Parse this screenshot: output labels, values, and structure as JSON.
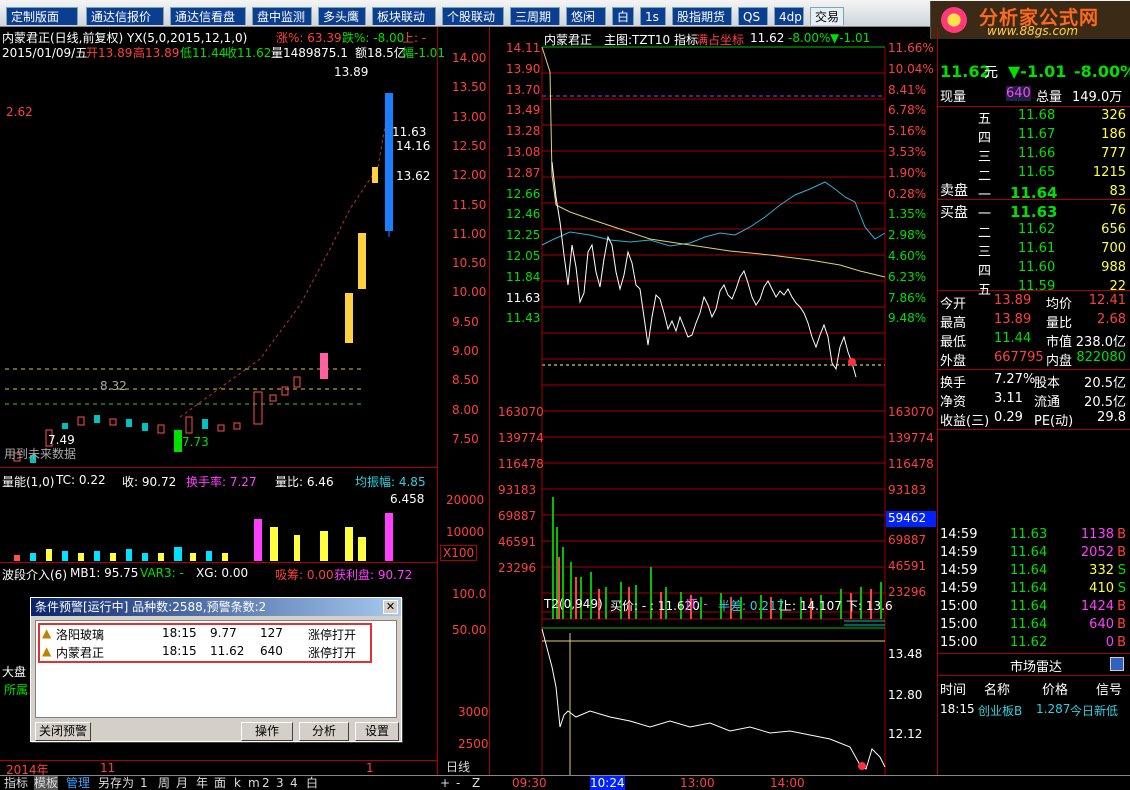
{
  "menu": [
    {
      "label": "定制版面",
      "active": false
    },
    {
      "label": "通达信报价",
      "active": false
    },
    {
      "label": "通达信看盘",
      "active": false
    },
    {
      "label": "盘中监测",
      "active": false
    },
    {
      "label": "多头鹰",
      "active": false
    },
    {
      "label": "板块联动",
      "active": false
    },
    {
      "label": "个股联动",
      "active": false
    },
    {
      "label": "三周期",
      "active": false
    },
    {
      "label": "悠闲",
      "active": false
    },
    {
      "label": "白",
      "active": false
    },
    {
      "label": "1s",
      "active": false
    },
    {
      "label": "股指期货",
      "active": false
    },
    {
      "label": "QS",
      "active": false
    },
    {
      "label": "4dp",
      "active": false
    },
    {
      "label": "交易",
      "active": true
    }
  ],
  "logo": {
    "brand": "分析家公式网",
    "url": "www.88gs.com"
  },
  "kline": {
    "title": "内蒙君正(日线,前复权) YX(5,0,2015,12,1,0)",
    "chg_label": "涨%: 63.39",
    "fall_label": "跌%: -8.00",
    "up_label": "上: -",
    "down_label": "下:",
    "date": "2015/01/09/五",
    "open": "开13.89",
    "high": "高13.89",
    "low": "低11.44",
    "close": "收11.62",
    "vol": "量1489875.1",
    "amt": "额18.5亿",
    "amp": "幅-1.01",
    "left_value": "2.62",
    "ann_high": "13.89",
    "ann_a": "11.63",
    "ann_b": "14.16",
    "ann_c": "13.62",
    "ann_d": "8.32",
    "ann_low": "7.49",
    "ann_mid": "7.73",
    "hint": "用到未来数据",
    "price_axis": [
      "14.00",
      "13.50",
      "13.00",
      "12.50",
      "12.00",
      "11.50",
      "11.00",
      "10.50",
      "10.00",
      "9.50",
      "9.00",
      "8.50",
      "8.00",
      "7.50"
    ]
  },
  "volume": {
    "title": "量能(1,0)",
    "tc": "TC: 0.22",
    "shou": "收: 90.72",
    "turn": "换手率: 7.27",
    "ratio": "量比: 6.46",
    "amp": "均振幅: 4.85",
    "peak": "6.458",
    "axis": [
      "20000",
      "10000"
    ],
    "unit": "X100"
  },
  "wave": {
    "title": "波段介入(6)",
    "mb1": "MB1: 95.75",
    "var3": "VAR3: -",
    "xg": "XG: 0.00",
    "xichou": "吸筹: 0.00",
    "profit": "获利盘: 90.72",
    "axis": [
      "100.0",
      "50.00"
    ],
    "axis2": [
      "3000",
      "2500"
    ],
    "label1": "大盘",
    "label2": "所属"
  },
  "alert": {
    "title": "条件预警[运行中] 品种数:2588,预警条数:2",
    "rows": [
      {
        "name": "洛阳玻璃",
        "time": "18:15",
        "price": "9.77",
        "vol": "127",
        "event": "涨停打开"
      },
      {
        "name": "内蒙君正",
        "time": "18:15",
        "price": "11.62",
        "vol": "640",
        "event": "涨停打开"
      }
    ],
    "buttons": {
      "close": "关闭预警",
      "op": "操作",
      "analyze": "分析",
      "settings": "设置"
    }
  },
  "intraday": {
    "title": "内蒙君正",
    "main": "主图:TZT10 指标",
    "hint": "满占坐标",
    "price": "11.62",
    "pct": "-8.00%",
    "chg": "▼-1.01",
    "price_axis": [
      "14.11",
      "13.90",
      "13.70",
      "13.49",
      "13.28",
      "13.08",
      "12.87",
      "12.66",
      "12.46",
      "12.25",
      "12.05",
      "11.84",
      "11.63",
      "11.43"
    ],
    "pct_axis": [
      "11.66%",
      "10.04%",
      "8.41%",
      "6.78%",
      "5.16%",
      "3.53%",
      "1.90%",
      "0.28%",
      "1.35%",
      "2.98%",
      "4.60%",
      "6.23%",
      "7.86%",
      "9.48%"
    ],
    "vol_axis": [
      "163070",
      "139774",
      "116478",
      "93183",
      "69887",
      "46591",
      "23296"
    ],
    "vol_marker": "59462",
    "t2": "T2(0,949)",
    "buy": "买价: - : 11.620",
    "jt": "JT: -",
    "banchai": "半差: 0.217",
    "shang": "上: 14.107",
    "xia": "下: 13.6",
    "t2_axis": [
      "13.48",
      "12.80",
      "12.12"
    ],
    "times": [
      "09:30",
      "10:24",
      "13:00",
      "14:00"
    ],
    "period": "日线"
  },
  "quote": {
    "price": "11.62",
    "unit": "元",
    "chg": "▼-1.01",
    "pct": "-8.00%",
    "now_vol_label": "现量",
    "now_vol": "640",
    "tot_label": "总量",
    "tot": "149.0万",
    "sell": [
      {
        "lv": "五",
        "p": "11.68",
        "v": "326"
      },
      {
        "lv": "四",
        "p": "11.67",
        "v": "186"
      },
      {
        "lv": "三",
        "p": "11.66",
        "v": "777"
      },
      {
        "lv": "二",
        "p": "11.65",
        "v": "1215"
      },
      {
        "lv": "一",
        "p": "11.64",
        "v": "83"
      }
    ],
    "sell_label": "卖盘",
    "buy_label": "买盘",
    "buy": [
      {
        "lv": "一",
        "p": "11.63",
        "v": "76"
      },
      {
        "lv": "二",
        "p": "11.62",
        "v": "656"
      },
      {
        "lv": "三",
        "p": "11.61",
        "v": "700"
      },
      {
        "lv": "四",
        "p": "11.60",
        "v": "988"
      },
      {
        "lv": "五",
        "p": "11.59",
        "v": "22"
      }
    ],
    "stats": [
      {
        "l1": "今开",
        "v1": "13.89",
        "l2": "均价",
        "v2": "12.41"
      },
      {
        "l1": "最高",
        "v1": "13.89",
        "l2": "量比",
        "v2": "2.68"
      },
      {
        "l1": "最低",
        "v1": "11.44",
        "l2": "市值",
        "v2": "238.0亿"
      },
      {
        "l1": "外盘",
        "v1": "667795",
        "l2": "内盘",
        "v2": "822080"
      }
    ],
    "fin": [
      {
        "l1": "换手",
        "v1": "7.27%",
        "l2": "股本",
        "v2": "20.5亿"
      },
      {
        "l1": "净资",
        "v1": "3.11",
        "l2": "流通",
        "v2": "20.5亿"
      },
      {
        "l1": "收益(三)",
        "v1": "0.29",
        "l2": "PE(动)",
        "v2": "29.8"
      }
    ],
    "ticks": [
      {
        "t": "14:59",
        "p": "11.63",
        "v": "1138",
        "s": "B"
      },
      {
        "t": "14:59",
        "p": "11.64",
        "v": "2052",
        "s": "B"
      },
      {
        "t": "14:59",
        "p": "11.64",
        "v": "332",
        "s": "S"
      },
      {
        "t": "14:59",
        "p": "11.64",
        "v": "410",
        "s": "S"
      },
      {
        "t": "15:00",
        "p": "11.64",
        "v": "1424",
        "s": "B"
      },
      {
        "t": "15:00",
        "p": "11.64",
        "v": "640",
        "s": "B"
      },
      {
        "t": "15:00",
        "p": "11.62",
        "v": "0",
        "s": "B"
      }
    ],
    "radar_label": "市场雷达",
    "radar_cols": [
      "时间",
      "名称",
      "价格",
      "信号"
    ],
    "radar_row": {
      "t": "18:15",
      "name": "创业板B",
      "price": "1.287",
      "sig": "今日新低"
    }
  },
  "bottom": {
    "tabs": [
      "指标",
      "模板",
      "管理",
      "另存为",
      "1",
      "周",
      "月",
      "年",
      "面",
      "k",
      "m",
      "2",
      "3",
      "4",
      "白"
    ],
    "year": "2014年",
    "m11": "11",
    "m1": "1"
  }
}
